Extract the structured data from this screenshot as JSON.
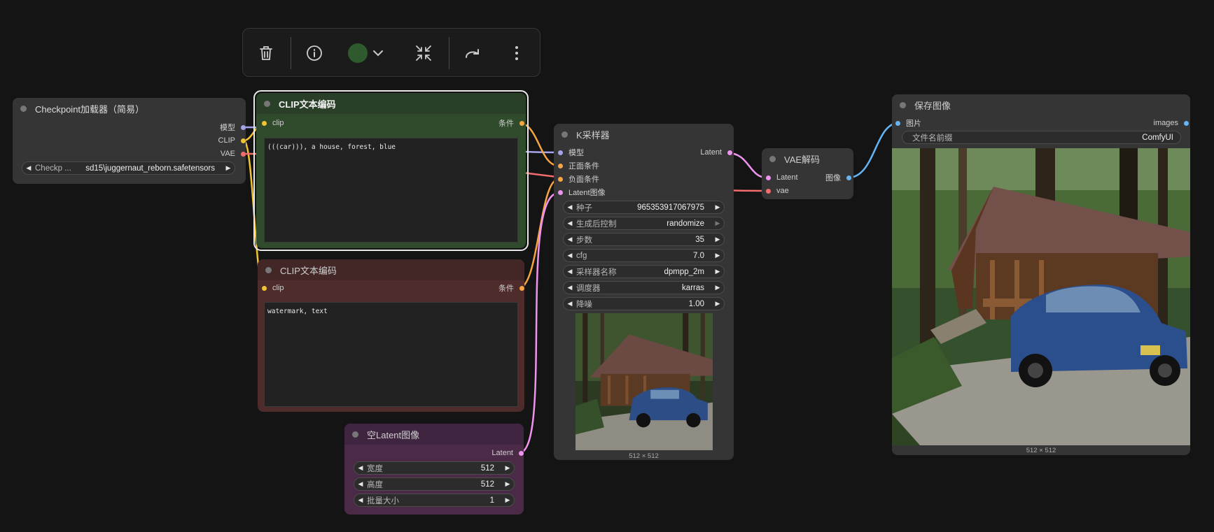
{
  "toolbar": {
    "buttons": [
      "trash-icon",
      "info-icon",
      "color-picker",
      "collapse-icon",
      "redo-icon",
      "more-icon"
    ],
    "color_swatch": "#2e5a2e"
  },
  "colors": {
    "clip": "#f1c232",
    "vae": "#f46c6c",
    "model": "#a5a3ec",
    "conditioning": "#f7a542",
    "latent": "#ee93ee",
    "image": "#64b5f6",
    "green_node": "#2f4b2c",
    "red_node": "#4e2c2c",
    "purple_node": "#4b2a48"
  },
  "checkpoint": {
    "title": "Checkpoint加载器（简易）",
    "outputs": [
      "模型",
      "CLIP",
      "VAE"
    ],
    "ckpt_label": "Checkp ...",
    "ckpt_value": "sd15\\juggernaut_reborn.safetensors"
  },
  "clip_pos": {
    "title": "CLIP文本编码",
    "input": "clip",
    "output": "条件",
    "text": "(((car))), a house, forest, blue"
  },
  "clip_neg": {
    "title": "CLIP文本编码",
    "input": "clip",
    "output": "条件",
    "text": "watermark, text"
  },
  "latent": {
    "title": "空Latent图像",
    "output": "Latent",
    "widgets": [
      {
        "label": "宽度",
        "value": "512"
      },
      {
        "label": "高度",
        "value": "512"
      },
      {
        "label": "批量大小",
        "value": "1"
      }
    ]
  },
  "ksampler": {
    "title": "K采样器",
    "inputs": [
      "模型",
      "正面条件",
      "负面条件",
      "Latent图像"
    ],
    "output": "Latent",
    "widgets": [
      {
        "label": "种子",
        "value": "965353917067975"
      },
      {
        "label": "生成后控制",
        "value": "randomize"
      },
      {
        "label": "步数",
        "value": "35"
      },
      {
        "label": "cfg",
        "value": "7.0"
      },
      {
        "label": "采样器名称",
        "value": "dpmpp_2m"
      },
      {
        "label": "调度器",
        "value": "karras"
      },
      {
        "label": "降噪",
        "value": "1.00"
      }
    ],
    "caption": "512 × 512"
  },
  "vaedecode": {
    "title": "VAE解码",
    "inputs": [
      "Latent",
      "vae"
    ],
    "output": "图像"
  },
  "save": {
    "title": "保存图像",
    "input": "图片",
    "output": "images",
    "prefix_label": "文件名前缀",
    "prefix_value": "ComfyUI",
    "caption": "512 × 512"
  }
}
